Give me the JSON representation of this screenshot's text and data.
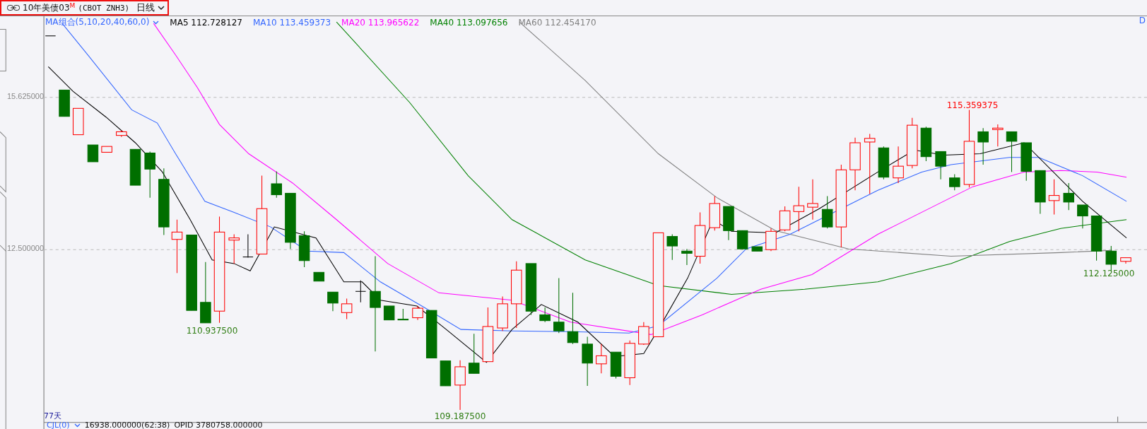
{
  "header": {
    "instrument": "10年美债03",
    "flag": "M",
    "code": "(CBOT ZNH3)",
    "period": "日线"
  },
  "legend": {
    "group": "MA组合(5,10,20,40,60,0)",
    "items": [
      {
        "label": "MA5 112.728127",
        "color": "#000000"
      },
      {
        "label": "MA10 113.459373",
        "color": "#3366ff"
      },
      {
        "label": "MA20 113.965622",
        "color": "#ff00ff"
      },
      {
        "label": "MA40 113.097656",
        "color": "#008000"
      },
      {
        "label": "MA60 112.454170",
        "color": "#808080"
      }
    ]
  },
  "corner_label": "D",
  "price_axis": {
    "labels": [
      "15.625000",
      "12.500000"
    ]
  },
  "annotations": [
    {
      "text": "115.359375",
      "kind": "high"
    },
    {
      "text": "110.937500",
      "kind": "low"
    },
    {
      "text": "109.187500",
      "kind": "low"
    },
    {
      "text": "112.125000",
      "kind": "low"
    }
  ],
  "day_count": "77天",
  "indicator": {
    "name": "CJL(0)",
    "value": "16938.000000(62:38)",
    "opid": "OPID 3780758.000000"
  }
}
